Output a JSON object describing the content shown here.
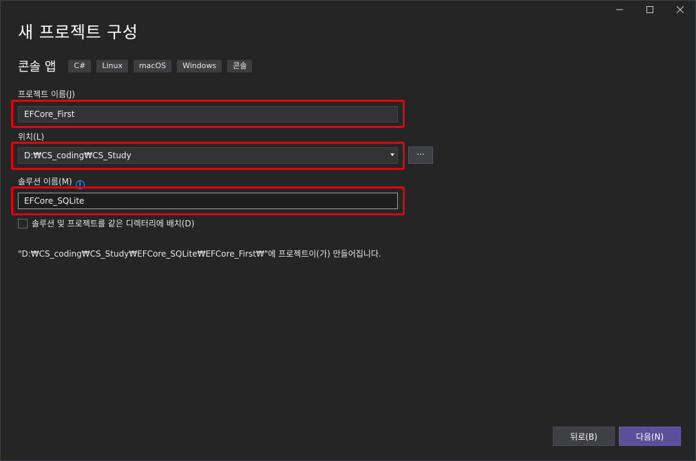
{
  "window": {
    "controls": {
      "minimize": "─",
      "maximize": "☐",
      "close": "✕"
    }
  },
  "page": {
    "title": "새 프로젝트 구성"
  },
  "template": {
    "name": "콘솔 앱",
    "tags": [
      "C#",
      "Linux",
      "macOS",
      "Windows",
      "콘솔"
    ]
  },
  "form": {
    "project_name": {
      "label": "프로젝트 이름(J)",
      "value": "EFCore_First"
    },
    "location": {
      "label": "위치(L)",
      "value": "D:₩CS_coding₩CS_Study",
      "browse_label": "..."
    },
    "solution_name": {
      "label": "솔루션 이름(M)",
      "info_icon": "i",
      "value": "EFCore_SQLite"
    },
    "same_directory": {
      "label": "솔루션 및 프로젝트를 같은 디렉터리에 배치(D)",
      "checked": false
    },
    "path_note": "\"D:₩CS_coding₩CS_Study₩EFCore_SQLite₩EFCore_First₩\"에 프로젝트이(가) 만들어집니다."
  },
  "footer": {
    "back_label": "뒤로(B)",
    "next_label": "다음(N)"
  },
  "colors": {
    "background": "#252526",
    "highlight": "#e3000f",
    "primary_button": "#5a4f98",
    "info": "#3794ff"
  }
}
